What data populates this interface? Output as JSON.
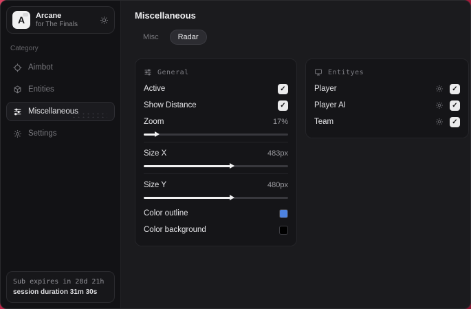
{
  "app": {
    "name": "Arcane",
    "subtitle": "for The Finals",
    "logo_letter": "A"
  },
  "sidebar": {
    "category_label": "Category",
    "items": [
      {
        "label": "Aimbot",
        "icon": "crosshair-icon"
      },
      {
        "label": "Entities",
        "icon": "cube-icon"
      },
      {
        "label": "Miscellaneous",
        "icon": "sliders-icon",
        "active": true
      },
      {
        "label": "Settings",
        "icon": "gear-icon"
      }
    ],
    "sub_status": {
      "line1": "Sub expires in 28d 21h",
      "line2": "session duration 31m 30s"
    }
  },
  "header": {
    "title": "Miscellaneous",
    "tabs": [
      {
        "label": "Misc",
        "active": false
      },
      {
        "label": "Radar",
        "active": true
      }
    ]
  },
  "panels": {
    "general": {
      "title": "General",
      "toggles": [
        {
          "label": "Active",
          "checked": true
        },
        {
          "label": "Show Distance",
          "checked": true
        }
      ],
      "sliders": [
        {
          "label": "Zoom",
          "value": "17%",
          "percent": 8
        },
        {
          "label": "Size X",
          "value": "483px",
          "percent": 60
        },
        {
          "label": "Size Y",
          "value": "480px",
          "percent": 60
        }
      ],
      "colors": [
        {
          "label": "Color outline",
          "hex": "#4d82e0"
        },
        {
          "label": "Color background",
          "hex": "#000000"
        }
      ]
    },
    "entities": {
      "title": "Entityes",
      "rows": [
        {
          "label": "Player",
          "checked": true
        },
        {
          "label": "Player AI",
          "checked": true
        },
        {
          "label": "Team",
          "checked": true
        }
      ]
    }
  },
  "colors": {
    "accent_background": "#a81c3c",
    "checkbox": "#ebebec",
    "outline_swatch": "#4d82e0",
    "background_swatch": "#000000"
  }
}
